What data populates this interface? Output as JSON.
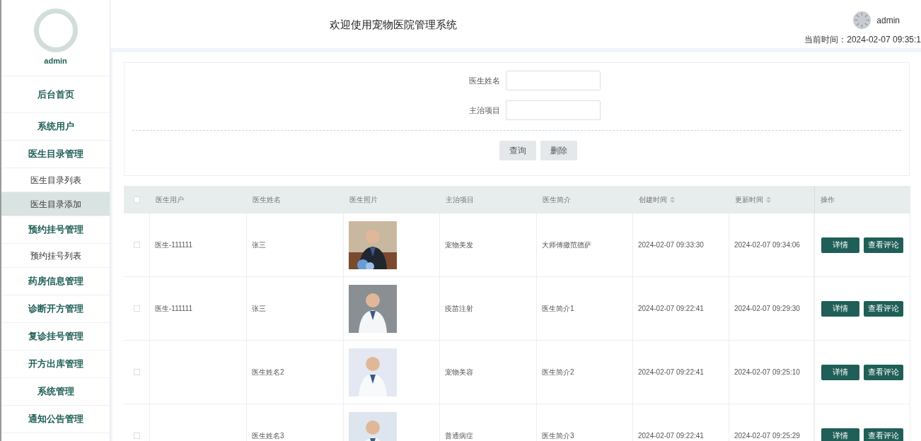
{
  "sidebar": {
    "username": "admin",
    "items": [
      {
        "label": "后台首页",
        "kind": "group",
        "selected": false
      },
      {
        "label": "系统用户",
        "kind": "group",
        "selected": false
      },
      {
        "label": "医生目录管理",
        "kind": "group",
        "selected": false
      },
      {
        "label": "医生目录列表",
        "kind": "link",
        "selected": false
      },
      {
        "label": "医生目录添加",
        "kind": "link",
        "selected": true
      },
      {
        "label": "预约挂号管理",
        "kind": "group",
        "selected": false
      },
      {
        "label": "预约挂号列表",
        "kind": "link",
        "selected": false
      },
      {
        "label": "药房信息管理",
        "kind": "group",
        "selected": false
      },
      {
        "label": "诊断开方管理",
        "kind": "group",
        "selected": false
      },
      {
        "label": "复诊挂号管理",
        "kind": "group",
        "selected": false
      },
      {
        "label": "开方出库管理",
        "kind": "group",
        "selected": false
      },
      {
        "label": "系统管理",
        "kind": "group",
        "selected": false
      },
      {
        "label": "通知公告管理",
        "kind": "group",
        "selected": false
      }
    ]
  },
  "header": {
    "title": "欢迎使用宠物医院管理系统",
    "user": "admin",
    "time": "当前时间：2024-02-07 09:35:1"
  },
  "search": {
    "fields": [
      {
        "label": "医生姓名"
      },
      {
        "label": "主治项目"
      }
    ],
    "buttons": [
      "查询",
      "删除"
    ]
  },
  "table": {
    "all_checked": false,
    "columns": [
      {
        "label": "医生用户",
        "kind": "plain"
      },
      {
        "label": "医生姓名",
        "kind": "plain"
      },
      {
        "label": "医生照片",
        "kind": "plain"
      },
      {
        "label": "主治项目",
        "kind": "plain"
      },
      {
        "label": "医生简介",
        "kind": "plain"
      },
      {
        "label": "创建时间",
        "kind": "sortable"
      },
      {
        "label": "更新时间",
        "kind": "sortable"
      },
      {
        "label": "操作",
        "kind": "plain"
      }
    ],
    "rows": [
      {
        "checked": false,
        "user": "医生-111111",
        "name": "张三",
        "project": "宠物美发",
        "intro": "大师傅撒范德萨",
        "created": "2024-02-07 09:33:30",
        "updated": "2024-02-07 09:34:06",
        "actions": [
          "详情",
          "查看评论"
        ]
      },
      {
        "checked": false,
        "user": "医生-111111",
        "name": "张三",
        "project": "疫苗注射",
        "intro": "医生简介1",
        "created": "2024-02-07 09:22:41",
        "updated": "2024-02-07 09:29:30",
        "actions": [
          "详情",
          "查看评论"
        ]
      },
      {
        "checked": false,
        "name": "医生姓名2",
        "project": "宠物美容",
        "intro": "医生简介2",
        "created": "2024-02-07 09:22:41",
        "updated": "2024-02-07 09:25:10",
        "actions": [
          "详情",
          "查看评论"
        ]
      },
      {
        "checked": false,
        "name": "医生姓名3",
        "project": "普通病症",
        "intro": "医生简介3",
        "created": "2024-02-07 09:22:41",
        "updated": "2024-02-07 09:25:29",
        "actions": [
          "详情",
          "查看评论"
        ]
      }
    ]
  }
}
